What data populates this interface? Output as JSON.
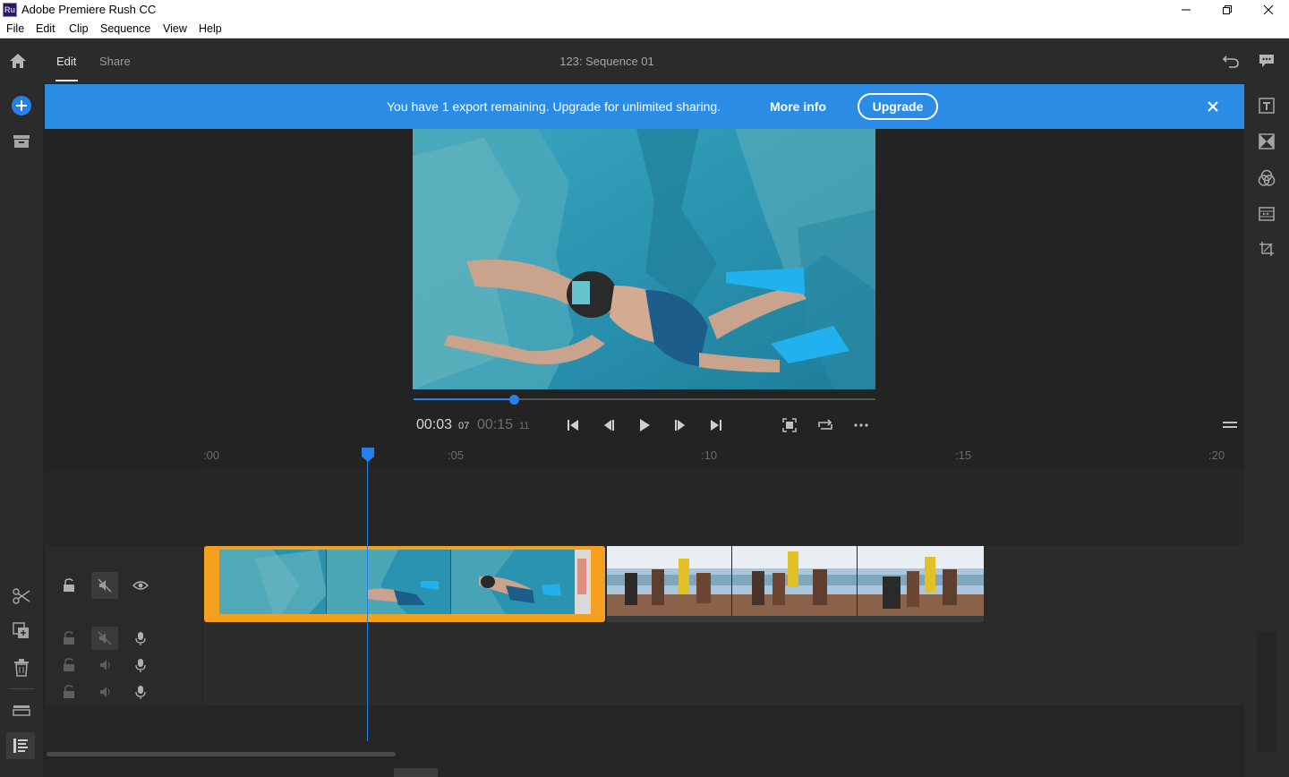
{
  "window": {
    "app_icon_text": "Ru",
    "title": "Adobe Premiere Rush CC",
    "controls": [
      "minimize",
      "restore",
      "close"
    ]
  },
  "menu": [
    "File",
    "Edit",
    "Clip",
    "Sequence",
    "View",
    "Help"
  ],
  "header": {
    "tabs": [
      {
        "label": "Edit",
        "active": true
      },
      {
        "label": "Share",
        "active": false
      }
    ],
    "sequence_title": "123: Sequence 01"
  },
  "banner": {
    "message": "You have 1 export remaining. Upgrade for unlimited sharing.",
    "more_info": "More info",
    "upgrade": "Upgrade"
  },
  "player": {
    "current_time": "00:03",
    "current_frame": "07",
    "total_time": "00:15",
    "total_frame": "11",
    "scrub_progress": 0.22
  },
  "ruler": {
    "ticks": [
      ":00",
      ":05",
      ":10",
      ":15",
      ":20"
    ]
  },
  "colors": {
    "accent": "#2680eb",
    "banner": "#2b8ce5",
    "clip_selected": "#f59f1f",
    "panel": "#2b2b2b",
    "background": "#232323"
  },
  "left_tools": [
    "add-media-icon",
    "projects-icon",
    "split-icon",
    "duplicate-icon",
    "delete-icon",
    "track-controls-icon",
    "timeline-list-icon"
  ],
  "right_tools": [
    "titles-icon",
    "transitions-icon",
    "color-icon",
    "speed-icon",
    "transform-icon"
  ]
}
